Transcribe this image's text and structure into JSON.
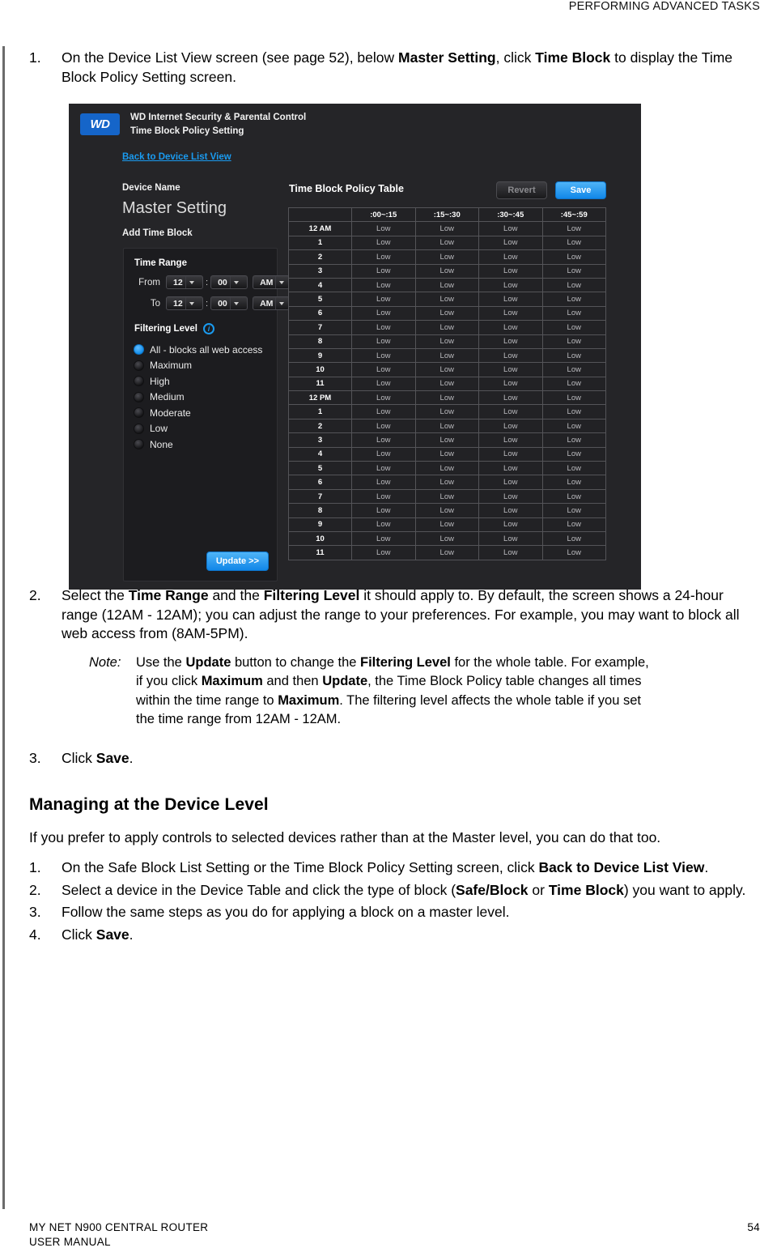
{
  "page": {
    "running_head": "PERFORMING ADVANCED TASKS",
    "footer_line1": "MY NET N900 CENTRAL ROUTER",
    "footer_line2": "USER MANUAL",
    "page_number": "54"
  },
  "steps": {
    "s1_num": "1.",
    "s1_a": "On the Device List View screen (see page 52), below ",
    "s1_b": "Master Setting",
    "s1_c": ", click ",
    "s1_d": "Time Block",
    "s1_e": " to display the Time Block Policy Setting screen.",
    "s2_num": "2.",
    "s2_a": "Select the ",
    "s2_b": "Time Range",
    "s2_c": " and the ",
    "s2_d": "Filtering Level",
    "s2_e": " it should apply to. By default, the screen shows a 24-hour range (12AM - 12AM); you can adjust the range to your preferences. For example, you may want to block all web access from (8AM-5PM).",
    "note_label": "Note:",
    "note_a": "Use the ",
    "note_b": "Update",
    "note_c": " button to change the ",
    "note_d": "Filtering Level",
    "note_e": " for the whole table. For example, if you click ",
    "note_f": "Maximum",
    "note_g": " and then ",
    "note_h": "Update",
    "note_i": ", the Time Block Policy table changes all times within the time range to ",
    "note_j": "Maximum",
    "note_k": ". The filtering level affects the whole table if you set the time range from 12AM - 12AM.",
    "s3_num": "3.",
    "s3_a": "Click ",
    "s3_b": "Save",
    "s3_c": "."
  },
  "section": {
    "heading": "Managing at the Device Level",
    "intro": "If you prefer to apply controls to selected devices rather than at the Master level, you can do that too.",
    "d1_num": "1.",
    "d1_a": "On the Safe Block List Setting or the Time Block Policy Setting screen, click ",
    "d1_b": "Back to Device List View",
    "d1_c": ".",
    "d2_num": "2.",
    "d2_a": "Select a device in the Device Table and click the type of block (",
    "d2_b": "Safe/Block",
    "d2_c": " or ",
    "d2_d": "Time Block",
    "d2_e": ") you want to apply.",
    "d3_num": "3.",
    "d3_a": "Follow the same steps as you do for applying a block on a master level.",
    "d4_num": "4.",
    "d4_a": "Click ",
    "d4_b": "Save",
    "d4_c": "."
  },
  "app": {
    "logo_text": "WD",
    "title_line1": "WD Internet Security & Parental Control",
    "title_line2": "Time Block Policy Setting",
    "back_link": "Back to Device List View",
    "device_name_label": "Device Name",
    "device_name_value": "Master Setting",
    "add_time_block_label": "Add Time Block",
    "time_range": {
      "heading": "Time Range",
      "from_label": "From",
      "to_label": "To",
      "colon": ":",
      "from_hour": "12",
      "from_minute": "00",
      "from_meridiem": "AM",
      "to_hour": "12",
      "to_minute": "00",
      "to_meridiem": "AM"
    },
    "filtering_level": {
      "heading": "Filtering Level",
      "info_icon_glyph": "i",
      "selected": "All - blocks all web access",
      "options": [
        "All - blocks all web access",
        "Maximum",
        "High",
        "Medium",
        "Moderate",
        "Low",
        "None"
      ]
    },
    "update_button": "Update >>",
    "table_title": "Time Block Policy Table",
    "revert_button": "Revert",
    "save_button": "Save",
    "colors": {
      "accent_blue": "#1a9bf0",
      "panel_bg": "#1c1c1f",
      "app_bg": "#252528",
      "logo_blue": "#1565c9"
    },
    "chart_data": {
      "type": "table",
      "title": "Time Block Policy Table",
      "columns": [
        "",
        ":00~:15",
        ":15~:30",
        ":30~:45",
        ":45~:59"
      ],
      "rows": [
        [
          "12 AM",
          "Low",
          "Low",
          "Low",
          "Low"
        ],
        [
          "1",
          "Low",
          "Low",
          "Low",
          "Low"
        ],
        [
          "2",
          "Low",
          "Low",
          "Low",
          "Low"
        ],
        [
          "3",
          "Low",
          "Low",
          "Low",
          "Low"
        ],
        [
          "4",
          "Low",
          "Low",
          "Low",
          "Low"
        ],
        [
          "5",
          "Low",
          "Low",
          "Low",
          "Low"
        ],
        [
          "6",
          "Low",
          "Low",
          "Low",
          "Low"
        ],
        [
          "7",
          "Low",
          "Low",
          "Low",
          "Low"
        ],
        [
          "8",
          "Low",
          "Low",
          "Low",
          "Low"
        ],
        [
          "9",
          "Low",
          "Low",
          "Low",
          "Low"
        ],
        [
          "10",
          "Low",
          "Low",
          "Low",
          "Low"
        ],
        [
          "11",
          "Low",
          "Low",
          "Low",
          "Low"
        ],
        [
          "12 PM",
          "Low",
          "Low",
          "Low",
          "Low"
        ],
        [
          "1",
          "Low",
          "Low",
          "Low",
          "Low"
        ],
        [
          "2",
          "Low",
          "Low",
          "Low",
          "Low"
        ],
        [
          "3",
          "Low",
          "Low",
          "Low",
          "Low"
        ],
        [
          "4",
          "Low",
          "Low",
          "Low",
          "Low"
        ],
        [
          "5",
          "Low",
          "Low",
          "Low",
          "Low"
        ],
        [
          "6",
          "Low",
          "Low",
          "Low",
          "Low"
        ],
        [
          "7",
          "Low",
          "Low",
          "Low",
          "Low"
        ],
        [
          "8",
          "Low",
          "Low",
          "Low",
          "Low"
        ],
        [
          "9",
          "Low",
          "Low",
          "Low",
          "Low"
        ],
        [
          "10",
          "Low",
          "Low",
          "Low",
          "Low"
        ],
        [
          "11",
          "Low",
          "Low",
          "Low",
          "Low"
        ]
      ]
    }
  }
}
